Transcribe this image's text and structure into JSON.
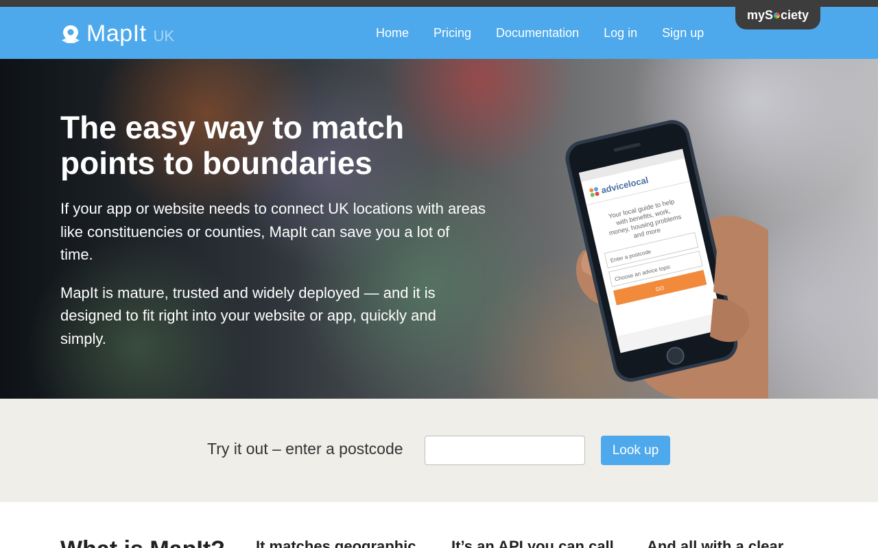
{
  "mysociety": {
    "label_pre": "myS",
    "label_post": "ciety"
  },
  "header": {
    "brand": "MapIt",
    "country": "UK",
    "nav": [
      "Home",
      "Pricing",
      "Documentation",
      "Log in",
      "Sign up"
    ]
  },
  "hero": {
    "title_line1": "The easy way to match",
    "title_line2": "points to boundaries",
    "p1": "If your app or website needs to connect UK locations with areas like constituencies or counties, MapIt can save you a lot of time.",
    "p2": "MapIt is mature, trusted and widely deployed — and it is designed to fit right into your website or app, quickly and simply."
  },
  "phone": {
    "site_name": "advicelocal",
    "tagline_1": "Your local guide to help",
    "tagline_2": "with benefits, work,",
    "tagline_3": "money, housing problems",
    "tagline_4": "and more",
    "postcode_placeholder": "Enter a postcode",
    "topic_placeholder": "Choose an advice topic",
    "go_label": "GO"
  },
  "tryit": {
    "label": "Try it out – enter a postcode",
    "input_value": "",
    "button_label": "Look up"
  },
  "features": {
    "h1": "What is MapIt?",
    "h2": "It matches geographic",
    "h3": "It’s an API you can call",
    "h4": "And all with a clear"
  },
  "colors": {
    "brand_blue": "#4ea9ec",
    "dark_bar": "#3d3d3d",
    "tryit_bg": "#f0eee9",
    "phone_button": "#f28a3c"
  }
}
